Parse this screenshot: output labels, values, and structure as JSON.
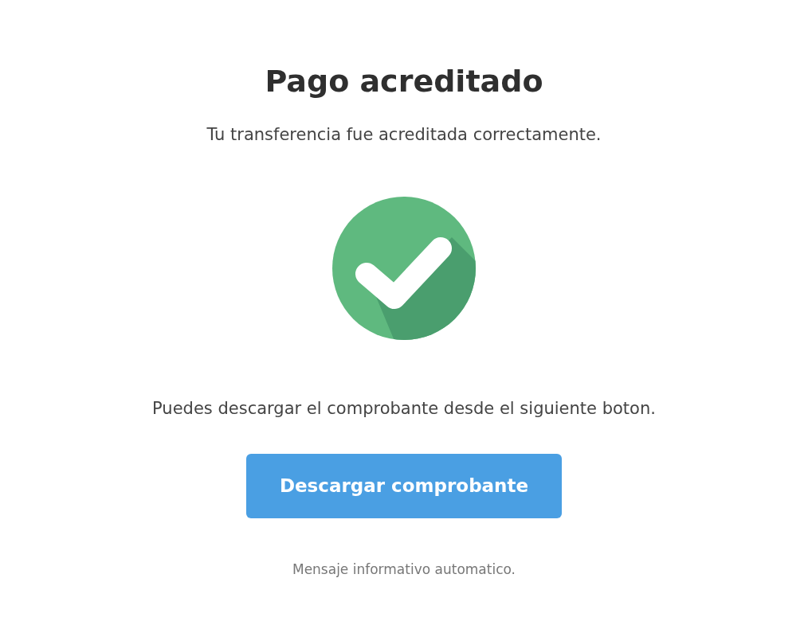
{
  "title": "Pago acreditado",
  "subtitle": "Tu transferencia fue acreditada correctamente.",
  "instruction": "Puedes descargar el comprobante desde el siguiente boton.",
  "button": {
    "label": "Descargar comprobante"
  },
  "footer": "Mensaje informativo automatico."
}
